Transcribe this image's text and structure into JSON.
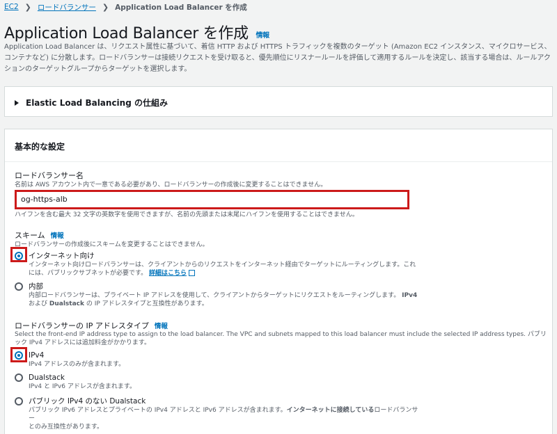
{
  "breadcrumb": {
    "root": "EC2",
    "parent": "ロードバランサー",
    "current": "Application Load Balancer を作成"
  },
  "page": {
    "title": "Application Load Balancer を作成",
    "info": "情報",
    "description": "Application Load Balancer は、リクエスト属性に基づいて、着信 HTTP および HTTPS トラフィックを複数のターゲット (Amazon EC2 インスタンス、マイクロサービス、コンテナなど) に分散します。ロードバランサーは接続リクエストを受け取ると、優先順位にリスナールールを評価して適用するルールを決定し、該当する場合は、ルールアクションのターゲットグループからターゲットを選択します。"
  },
  "expander": {
    "label": "Elastic Load Balancing の仕組み"
  },
  "basic": {
    "header": "基本的な設定",
    "name": {
      "label": "ロードバランサー名",
      "desc": "名前は AWS アカウント内で一意である必要があり、ロードバランサーの作成後に変更することはできません。",
      "value": "og-https-alb",
      "hint": "ハイフンを含む最大 32 文字の英数字を使用できますが、名前の先頭または末尾にハイフンを使用することはできません。"
    },
    "scheme": {
      "label": "スキーム",
      "info": "情報",
      "desc": "ロードバランサーの作成後にスキームを変更することはできません。",
      "options": [
        {
          "title": "インターネット向け",
          "desc": "インターネット向けロードバランサーは、クライアントからのリクエストをインターネット経由でターゲットにルーティングします。これには、パブリックサブネットが必要です。",
          "link": "詳細はこちら"
        },
        {
          "title": "内部",
          "desc1": "内部ロードバランサーは、プライベート IP アドレスを使用して、クライアントからターゲットにリクエストをルーティングします。",
          "desc1b": "IPv4",
          "desc2a": "および",
          "desc2b": "Dualstack",
          "desc2c": "の IP アドレスタイプと互換性があります。"
        }
      ]
    },
    "ipType": {
      "label": "ロードバランサーの IP アドレスタイプ",
      "info": "情報",
      "desc": "Select the front-end IP address type to assign to the load balancer. The VPC and subnets mapped to this load balancer must include the selected IP address types. パブリック IPv4 アドレスには追加料金がかかります。",
      "options": [
        {
          "title": "IPv4",
          "desc": "IPv4 アドレスのみが含まれます。"
        },
        {
          "title": "Dualstack",
          "desc": "IPv4 と IPv6 アドレスが含まれます。"
        },
        {
          "title": "パブリック IPv4 のない Dualstack",
          "desc1": "パブリック IPv6 アドレスとプライベートの IPv4 アドレスと IPv6 アドレスが含まれます。",
          "desc1b": "インターネットに接続している",
          "desc1c": "ロードバランサー",
          "desc2": "とのみ互換性があります。"
        }
      ]
    }
  }
}
